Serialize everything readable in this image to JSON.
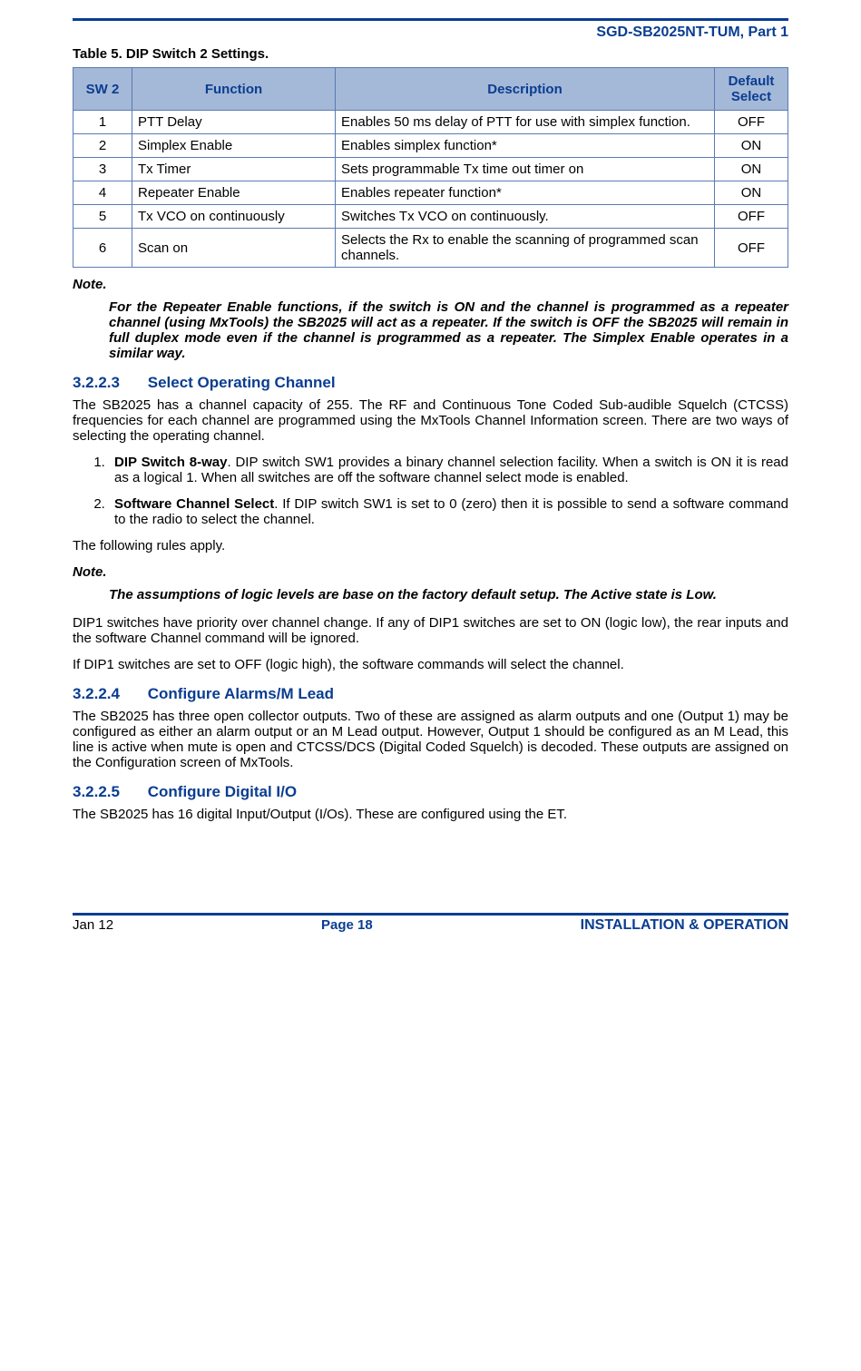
{
  "header": {
    "doc_id": "SGD-SB2025NT-TUM, Part 1"
  },
  "table5": {
    "caption": "Table 5.  DIP Switch 2 Settings.",
    "headers": {
      "sw2": "SW 2",
      "function": "Function",
      "description": "Description",
      "default": "Default Select"
    },
    "rows": [
      {
        "sw2": "1",
        "function": "PTT Delay",
        "description": "Enables 50 ms delay of PTT for use with simplex function.",
        "default": "OFF"
      },
      {
        "sw2": "2",
        "function": "Simplex Enable",
        "description": "Enables simplex function*",
        "default": "ON"
      },
      {
        "sw2": "3",
        "function": "Tx Timer",
        "description": "Sets programmable Tx time out timer on",
        "default": "ON"
      },
      {
        "sw2": "4",
        "function": "Repeater Enable",
        "description": "Enables repeater function*",
        "default": "ON"
      },
      {
        "sw2": "5",
        "function": "Tx VCO on continuously",
        "description": "Switches Tx VCO on continuously.",
        "default": "OFF"
      },
      {
        "sw2": "6",
        "function": "Scan on",
        "description": "Selects the Rx to enable the scanning of programmed scan channels.",
        "default": "OFF"
      }
    ]
  },
  "note1": {
    "label": "Note.",
    "body": "For the Repeater Enable functions, if the switch is ON and the channel is programmed as a repeater channel (using MxTools) the SB2025 will act as a repeater.  If the switch is OFF the SB2025 will remain in full duplex mode even if the channel is programmed as a repeater.  The Simplex Enable operates in a similar way."
  },
  "section_3223": {
    "num": "3.2.2.3",
    "title": "Select Operating Channel",
    "intro": "The SB2025 has a channel capacity of 255.  The RF and Continuous Tone Coded Sub-audible Squelch (CTCSS) frequencies for each channel are programmed using the MxTools Channel Information screen.  There are two ways of selecting the operating channel.",
    "item1_lead": "DIP Switch 8-way",
    "item1_rest": ".  DIP switch SW1 provides a binary channel selection facility.  When a switch is ON it is read as a logical 1.  When all switches are off the software channel select mode is enabled.",
    "item2_lead": "Software Channel Select",
    "item2_rest": ".  If DIP switch SW1 is set to 0 (zero) then it is possible to send a software command to the radio to select the channel.",
    "rules_intro": "The following rules apply.",
    "note_label": "Note.",
    "note_body": "The assumptions of logic levels are base on the factory default setup.  The Active state is Low.",
    "p1": "DIP1 switches have priority over channel change.  If any of DIP1 switches are set to ON (logic low), the rear inputs and the software Channel command will be ignored.",
    "p2": "If DIP1 switches are set to OFF (logic high), the software commands will select the channel."
  },
  "section_3224": {
    "num": "3.2.2.4",
    "title": "Configure Alarms/M Lead",
    "body": "The SB2025 has three open collector outputs.  Two of these are assigned as alarm outputs and one (Output 1) may be configured as either an alarm output or an M Lead output.  However, Output 1 should be configured as an M Lead, this line is active when mute is open and CTCSS/DCS (Digital Coded Squelch) is decoded.  These outputs are assigned on the Configuration screen of MxTools."
  },
  "section_3225": {
    "num": "3.2.2.5",
    "title": "Configure Digital I/O",
    "body": "The SB2025 has 16 digital Input/Output (I/Os).  These are configured using the ET."
  },
  "footer": {
    "left": "Jan 12",
    "center": "Page 18",
    "right": "INSTALLATION & OPERATION"
  }
}
